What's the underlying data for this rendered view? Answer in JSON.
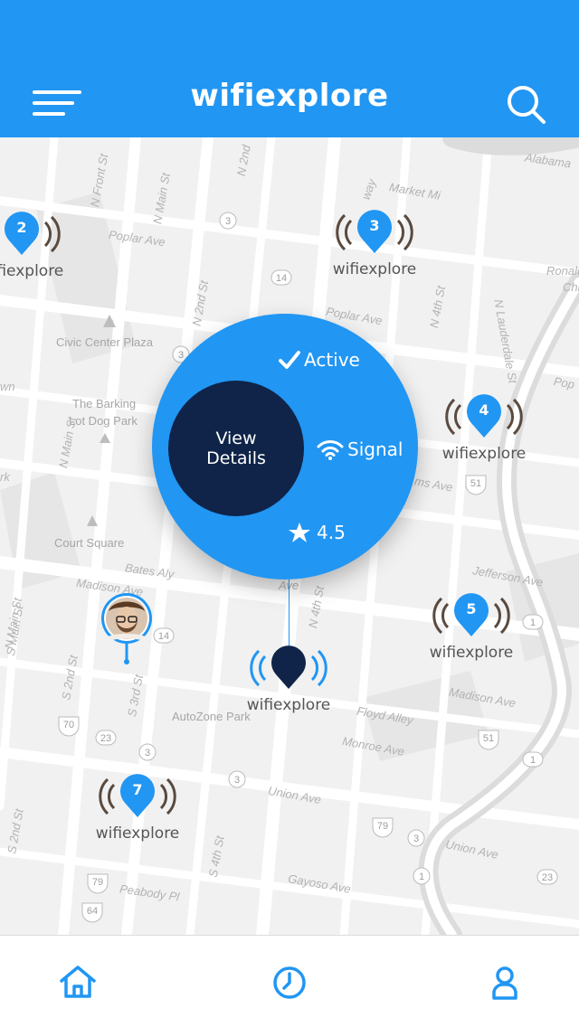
{
  "header": {
    "title": "wifiexplore",
    "menu_icon": "hamburger-menu-icon",
    "search_icon": "search-icon",
    "background": "#2196f3"
  },
  "map": {
    "streets": [
      "Alabama",
      "Market Mi",
      "Poplar Ave",
      "Poplar Ave",
      "Civic Center Plaza",
      "The Barking",
      "Lot Dog Park",
      "Court Square",
      "Bates Aly",
      "Madison Ave",
      "Jefferson Ave",
      "Madison Ave",
      "AutoZone Park",
      "Floyd Alley",
      "Monroe Ave",
      "Union Ave",
      "Union Ave",
      "Gayoso Ave",
      "Peabody Pl",
      "Ronald",
      "Chi",
      "N Front St",
      "N Main St",
      "N 2nd St",
      "N 2nd",
      "N Main St",
      "N Main St",
      "N 4th St",
      "N 4th St",
      "N Lauderdale St",
      "S Main St",
      "S 2nd St",
      "S 3rd St",
      "S 4th St",
      "S 2nd St",
      "way",
      "ms Ave",
      "wn",
      "rk",
      "Pop",
      "Ave"
    ],
    "highway_badges": [
      "3",
      "14",
      "3",
      "51",
      "1",
      "14",
      "70",
      "23",
      "3",
      "51",
      "1",
      "3",
      "79",
      "23",
      "3",
      "79",
      "64",
      "1"
    ]
  },
  "pins": [
    {
      "number": "2",
      "label": "wifiexplore"
    },
    {
      "number": "3",
      "label": "wifiexplore"
    },
    {
      "number": "4",
      "label": "wifiexplore"
    },
    {
      "number": "5",
      "label": "wifiexplore"
    },
    {
      "number": "7",
      "label": "wifiexplore"
    },
    {
      "number": "",
      "label": "wifiexplore"
    }
  ],
  "popup": {
    "status": "Active",
    "signal": "Signal",
    "rating": "4.5",
    "details_button": "View Details",
    "details_line1": "View",
    "details_line2": "Details"
  },
  "bottom_nav": {
    "items": [
      {
        "icon": "home-icon"
      },
      {
        "icon": "clock-icon"
      },
      {
        "icon": "profile-icon"
      }
    ],
    "accent": "#2196f3"
  },
  "colors": {
    "primary": "#2196f3",
    "dark_navy": "#0f2448",
    "signal_waves": "#5a4a3f"
  }
}
